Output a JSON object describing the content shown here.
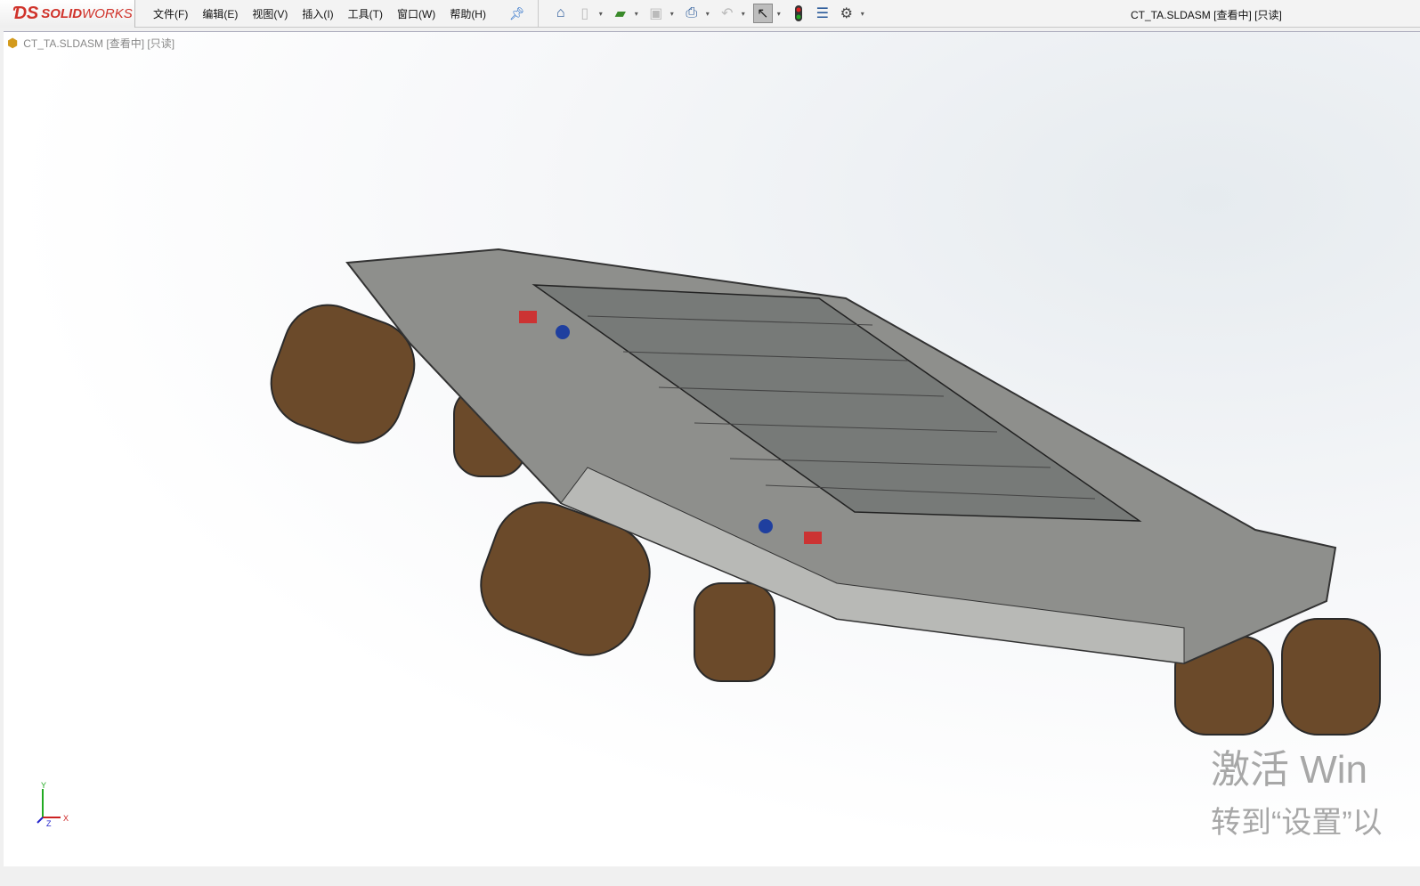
{
  "app": {
    "brand_prefix": "SOLID",
    "brand_suffix": "WORKS",
    "window_title": "CT_TA.SLDASM [查看中] [只读]"
  },
  "menu": [
    "文件(F)",
    "编辑(E)",
    "视图(V)",
    "插入(I)",
    "工具(T)",
    "窗口(W)",
    "帮助(H)"
  ],
  "toolbar": [
    "home-icon",
    "new-document-icon",
    "open-icon",
    "save-icon",
    "print-icon",
    "undo-icon",
    "select-icon",
    "rebuild-icon",
    "file-properties-icon",
    "options-icon"
  ],
  "document": {
    "tab_title": "CT_TA.SLDASM [查看中] [只读]"
  },
  "triad": {
    "x": "X",
    "y": "Y",
    "z": "Z"
  },
  "watermark": {
    "line1": "激活 Win",
    "line2": "转到“设置”以"
  }
}
